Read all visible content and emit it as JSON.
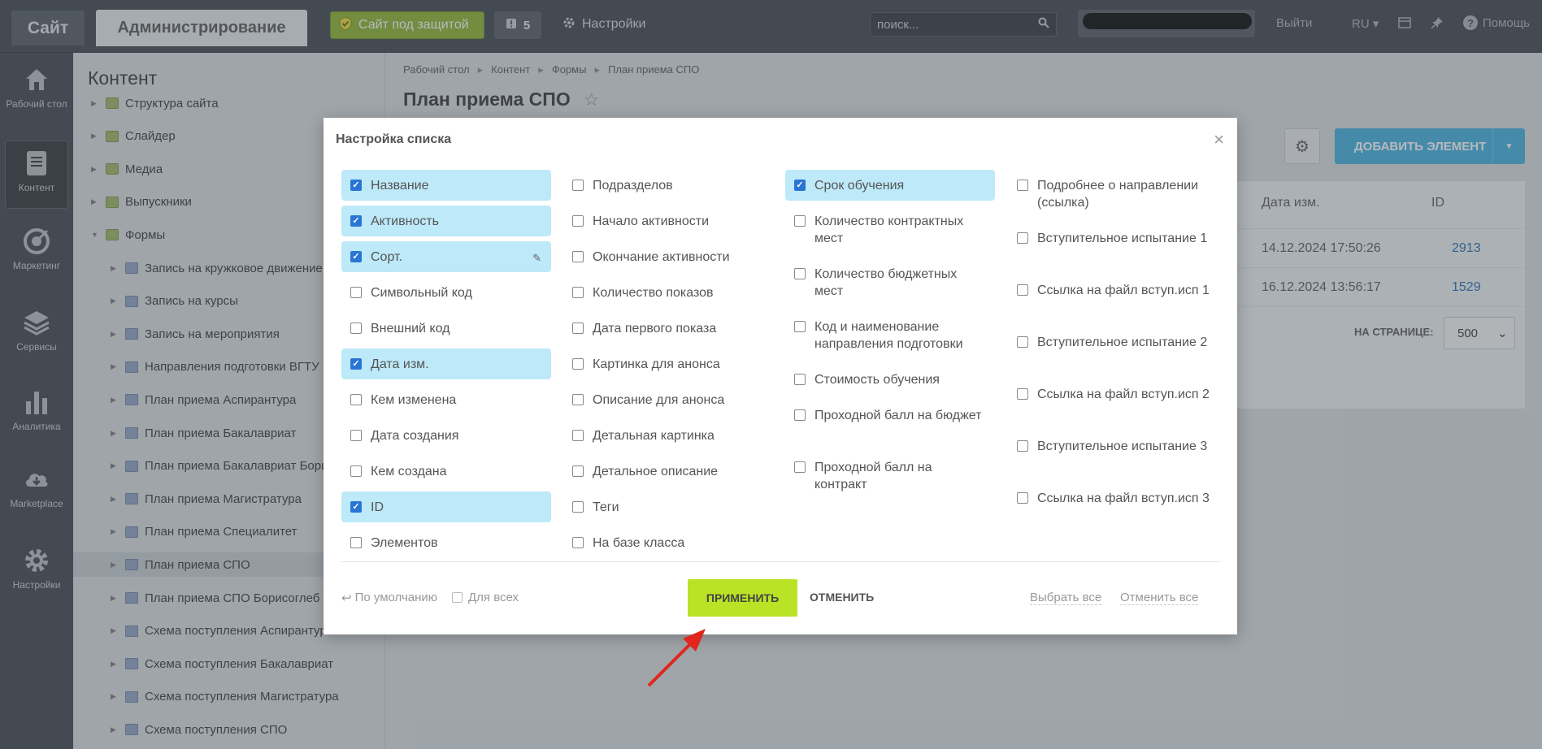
{
  "topbar": {
    "site_tab": "Сайт",
    "admin_tab": "Администрирование",
    "protect_label": "Сайт под защитой",
    "notif_count": "5",
    "settings_label": "Настройки",
    "search_placeholder": "поиск...",
    "logout": "Выйти",
    "lang": "RU",
    "help": "Помощь"
  },
  "leftnav": [
    {
      "label": "Рабочий стол",
      "icon": "home-icon"
    },
    {
      "label": "Контент",
      "icon": "content-icon"
    },
    {
      "label": "Маркетинг",
      "icon": "target-icon"
    },
    {
      "label": "Сервисы",
      "icon": "layers-icon"
    },
    {
      "label": "Аналитика",
      "icon": "chart-icon"
    },
    {
      "label": "Marketplace",
      "icon": "cloud-icon"
    },
    {
      "label": "Настройки",
      "icon": "gear-icon"
    }
  ],
  "tree": {
    "title": "Контент",
    "items": [
      {
        "label": "Структура сайта"
      },
      {
        "label": "Слайдер"
      },
      {
        "label": "Медиа"
      },
      {
        "label": "Выпускники"
      },
      {
        "label": "Формы"
      },
      {
        "label": "Запись на кружковое движение"
      },
      {
        "label": "Запись на курсы"
      },
      {
        "label": "Запись на мероприятия"
      },
      {
        "label": "Направления подготовки ВГТУ"
      },
      {
        "label": "План приема Аспирантура"
      },
      {
        "label": "План приема Бакалавриат"
      },
      {
        "label": "План приема Бакалавриат Бори"
      },
      {
        "label": "План приема Магистратура"
      },
      {
        "label": "План приема Специалитет"
      },
      {
        "label": "План приема СПО"
      },
      {
        "label": "План приема СПО Борисоглеб"
      },
      {
        "label": "Схема поступления Аспирантура"
      },
      {
        "label": "Схема поступления Бакалавриат"
      },
      {
        "label": "Схема поступления Магистратура"
      },
      {
        "label": "Схема поступления СПО"
      }
    ]
  },
  "main": {
    "breadcrumbs": [
      "Рабочий стол",
      "Контент",
      "Формы",
      "План приема СПО"
    ],
    "title": "План приема СПО",
    "add_button": "ДОБАВИТЬ ЭЛЕМЕНТ",
    "columns": {
      "date": "Дата изм.",
      "id": "ID"
    },
    "rows": [
      {
        "date": "14.12.2024 17:50:26",
        "id": "2913"
      },
      {
        "date": "16.12.2024 13:56:17",
        "id": "1529"
      }
    ],
    "per_page_label": "НА СТРАНИЦЕ:",
    "per_page_value": "500"
  },
  "modal": {
    "title": "Настройка списка",
    "col1": [
      {
        "label": "Название",
        "checked": true
      },
      {
        "label": "Активность",
        "checked": true
      },
      {
        "label": "Сорт.",
        "checked": true
      },
      {
        "label": "Символьный код",
        "checked": false
      },
      {
        "label": "Внешний код",
        "checked": false
      },
      {
        "label": "Дата изм.",
        "checked": true
      },
      {
        "label": "Кем изменена",
        "checked": false
      },
      {
        "label": "Дата создания",
        "checked": false
      },
      {
        "label": "Кем создана",
        "checked": false
      },
      {
        "label": "ID",
        "checked": true
      },
      {
        "label": "Элементов",
        "checked": false
      }
    ],
    "col2": [
      {
        "label": "Подразделов"
      },
      {
        "label": "Начало активности"
      },
      {
        "label": "Окончание активности"
      },
      {
        "label": "Количество показов"
      },
      {
        "label": "Дата первого показа"
      },
      {
        "label": "Картинка для анонса"
      },
      {
        "label": "Описание для анонса"
      },
      {
        "label": "Детальная картинка"
      },
      {
        "label": "Детальное описание"
      },
      {
        "label": "Теги"
      },
      {
        "label": "На базе класса"
      }
    ],
    "col3": [
      {
        "label": "Срок обучения",
        "checked": true
      },
      {
        "label": "Количество контрактных мест",
        "checked": false
      },
      {
        "label": "Количество бюджетных мест",
        "checked": false
      },
      {
        "label": "Код и наименование направления подготовки",
        "checked": false
      },
      {
        "label": "Стоимость обучения",
        "checked": false
      },
      {
        "label": "Проходной балл на бюджет",
        "checked": false
      },
      {
        "label": "Проходной балл на контракт",
        "checked": false
      }
    ],
    "col4": [
      {
        "label": "Подробнее о направлении (ссылка)"
      },
      {
        "label": "Вступительное испытание 1"
      },
      {
        "label": "Ссылка на файл вступ.исп 1"
      },
      {
        "label": "Вступительное испытание 2"
      },
      {
        "label": "Ссылка на файл вступ.исп 2"
      },
      {
        "label": "Вступительное испытание 3"
      },
      {
        "label": "Ссылка на файл вступ.исп 3"
      }
    ],
    "default_label": "По умолчанию",
    "forall_label": "Для всех",
    "apply_label": "ПРИМЕНИТЬ",
    "cancel_label": "ОТМЕНИТЬ",
    "select_all": "Выбрать все",
    "unselect_all": "Отменить все"
  },
  "colors": {
    "accent_green": "#b9e324",
    "checked_bg": "#bde9f9",
    "checkbox_blue": "#2a75d4",
    "arrow_red": "#e0261f"
  }
}
